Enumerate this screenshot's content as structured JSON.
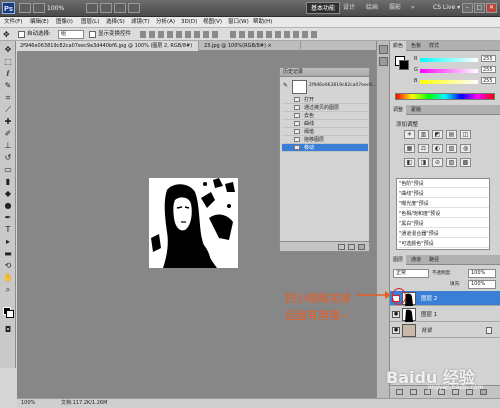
{
  "titlebar": {
    "logo": "Ps",
    "zoom": "100%",
    "workspaces": [
      "基本功能",
      "设计",
      "绘画",
      "摄影",
      "»"
    ],
    "cs_live": "CS Live ▾",
    "window_buttons": [
      "–",
      "□",
      "✕"
    ]
  },
  "menu": [
    "文件(F)",
    "编辑(E)",
    "图像(I)",
    "图层(L)",
    "选择(S)",
    "滤镜(T)",
    "分析(A)",
    "3D(D)",
    "视图(V)",
    "窗口(W)",
    "帮助(H)"
  ],
  "options": {
    "auto_select_label": "自动选择:",
    "auto_select_value": "组",
    "show_transform_label": "显示变换控件"
  },
  "tabs": [
    {
      "label": "2f946e063819c82ca07eec9a3d440bf6.jpg @ 100% (图层 2, RGB/8#) ×"
    },
    {
      "label": "23.jpg @ 100%(RGB/8#) ×"
    }
  ],
  "history": {
    "title": "历史记录",
    "snapshot": "2f946e063819c82ca07eec9...",
    "items": [
      "打开",
      "通过拷贝的图层",
      "去色",
      "曲线",
      "阈值",
      "拖移图层",
      "移动"
    ],
    "active_index": 6
  },
  "color_panel": {
    "tabs": [
      "颜色",
      "色板",
      "样式"
    ],
    "sliders": [
      {
        "label": "R",
        "value": "255",
        "color": "#ff6a6a"
      },
      {
        "label": "G",
        "value": "255",
        "color": "#6adc6a"
      },
      {
        "label": "B",
        "value": "255",
        "color": "#6a9aff"
      }
    ]
  },
  "adjustments": {
    "tabs": [
      "调整",
      "蒙版"
    ],
    "title": "添加调整",
    "row1": [
      "☀",
      "▥",
      "◩",
      "▤",
      "◫"
    ],
    "row2": [
      "▦",
      "⚖",
      "◐",
      "▧",
      "◍"
    ],
    "row3": [
      "◧",
      "◨",
      "⊘",
      "▨",
      "▩"
    ],
    "presets": [
      "\"色阶\"预设",
      "\"曲线\"预设",
      "\"曝光度\"预设",
      "\"色相/饱和度\"预设",
      "\"黑白\"预设",
      "\"通道混合器\"预设",
      "\"可选颜色\"预设"
    ]
  },
  "layers": {
    "tabs": [
      "图层",
      "通道",
      "路径"
    ],
    "blend_mode": "正常",
    "opacity_label": "不透明度:",
    "opacity": "100%",
    "fill_label": "填充:",
    "fill": "100%",
    "items": [
      {
        "name": "图层 2",
        "active": true
      },
      {
        "name": "图层 1",
        "active": false
      },
      {
        "name": "背景",
        "active": false
      }
    ]
  },
  "status": {
    "zoom": "100%",
    "doc": "文档:117.2K/1.26M"
  },
  "annotation": {
    "line1": "把小眼睛关掉",
    "line2": "后面有用哦~"
  },
  "watermark": {
    "brand": "Baidu 经验",
    "sub": "jingyan.baidu.com"
  },
  "colors": {
    "accent_selected": "#3a7fd6",
    "annotation": "#e85d24",
    "canvas_bg": "#878787"
  }
}
